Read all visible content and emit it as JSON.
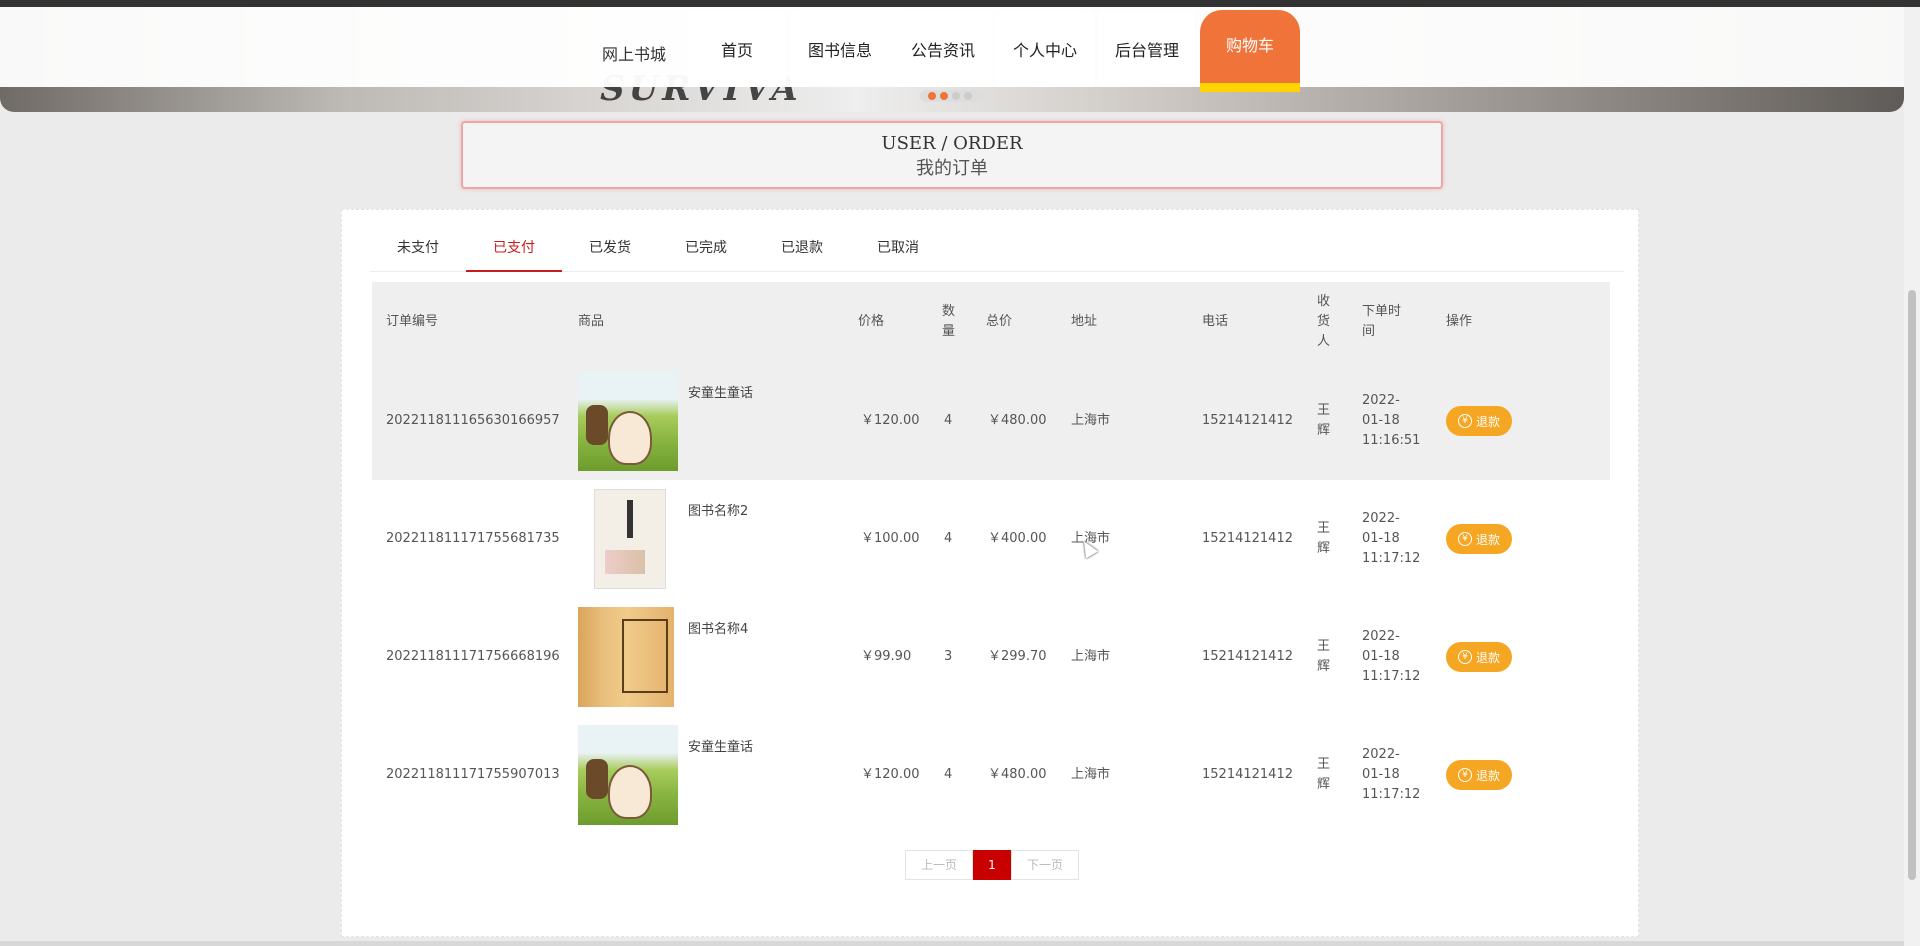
{
  "nav": {
    "brand": "网上书城",
    "items": [
      "首页",
      "图书信息",
      "公告资讯",
      "个人中心",
      "后台管理"
    ],
    "cart": "购物车"
  },
  "banner": {
    "text": "SURVIVA"
  },
  "title": {
    "en": "USER / ORDER",
    "cn": "我的订单"
  },
  "tabs": [
    "未支付",
    "已支付",
    "已发货",
    "已完成",
    "已退款",
    "已取消"
  ],
  "active_tab": "已支付",
  "table": {
    "headers": {
      "order_no": "订单编号",
      "product": "商品",
      "price": "价格",
      "qty": "数\n量",
      "total": "总价",
      "address": "地址",
      "phone": "电话",
      "receiver": "收\n货\n人",
      "time": "下单时\n间",
      "action": "操作"
    },
    "rows": [
      {
        "order_no": "2022118111656301669​57",
        "product": "安童生童话",
        "price": "￥120.00",
        "qty": "4",
        "total": "￥480.00",
        "address": "上海市",
        "phone": "15214121412",
        "receiver": "王\n辉",
        "time": "2022-\n01-18\n11:16:51",
        "action": "退款"
      },
      {
        "order_no": "20221181117175568173​5",
        "product": "图书名称2",
        "price": "￥100.00",
        "qty": "4",
        "total": "￥400.00",
        "address": "上海市",
        "phone": "15214121412",
        "receiver": "王\n辉",
        "time": "2022-\n01-18\n11:17:12",
        "action": "退款"
      },
      {
        "order_no": "2022118111717566681​96",
        "product": "图书名称4",
        "price": "￥99.90",
        "qty": "3",
        "total": "￥299.70",
        "address": "上海市",
        "phone": "15214121412",
        "receiver": "王\n辉",
        "time": "2022-\n01-18\n11:17:12",
        "action": "退款"
      },
      {
        "order_no": "2022118111717559070​13",
        "product": "安童生童话",
        "price": "￥120.00",
        "qty": "4",
        "total": "￥480.00",
        "address": "上海市",
        "phone": "15214121412",
        "receiver": "王\n辉",
        "time": "2022-\n01-18\n11:17:12",
        "action": "退款"
      }
    ]
  },
  "pager": {
    "prev": "上一页",
    "current": "1",
    "next": "下一页"
  },
  "colors": {
    "accent": "#f0733a",
    "active_red": "#c81c1c",
    "refund_orange": "#f5a623",
    "cart_bar": "#ffd400"
  }
}
